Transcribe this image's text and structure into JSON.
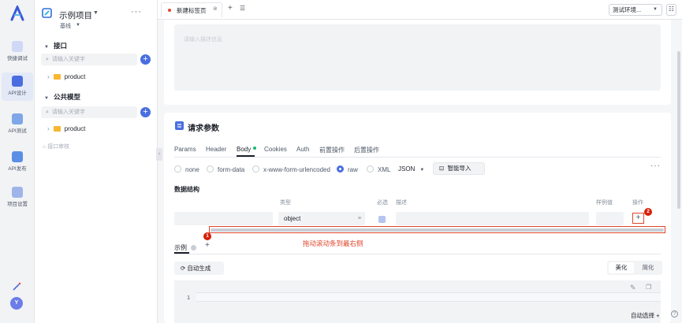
{
  "rail": {
    "items": [
      {
        "label": "快捷调试",
        "icon": "quick-debug-icon"
      },
      {
        "label": "API设计",
        "icon": "api-design-icon"
      },
      {
        "label": "API测试",
        "icon": "api-test-icon"
      },
      {
        "label": "API发布",
        "icon": "api-publish-icon"
      },
      {
        "label": "项目设置",
        "icon": "project-settings-icon"
      }
    ],
    "avatar": "Y"
  },
  "sidebar": {
    "project_name": "示例项目",
    "branch": "基线",
    "more": "···",
    "api_section": {
      "title": "接口",
      "search_placeholder": "请输入关键字",
      "folder": "product"
    },
    "model_section": {
      "title": "公共模型",
      "search_placeholder": "请输入关键字",
      "folder": "product"
    },
    "review": "接口审核"
  },
  "tabbar": {
    "tab_label": "新建标签页",
    "environment": "测试环境..."
  },
  "main": {
    "desc_placeholder": "请输入描述信息",
    "request_params_title": "请求参数",
    "subtabs": [
      "Params",
      "Header",
      "Body",
      "Cookies",
      "Auth",
      "前置操作",
      "后置操作"
    ],
    "body_types": [
      "none",
      "form-data",
      "x-www-form-urlencoded",
      "raw",
      "XML"
    ],
    "selected_body_type": "raw",
    "json_label": "JSON",
    "smart_import": "智能导入",
    "data_structure_title": "数据结构",
    "columns": {
      "type": "类型",
      "required": "必选",
      "desc": "描述",
      "sample": "样例值",
      "action": "操作"
    },
    "row": {
      "type_value": "object",
      "action_symbol": "+"
    },
    "badge1": "1",
    "badge2": "2",
    "note": "拖动滚动条到最右侧",
    "example_tab": "示例",
    "auto_generate": "自动生成",
    "beautify": "美化",
    "simplify": "简化",
    "line_number": "1"
  },
  "bottom": {
    "auto_select": "自动选择 +"
  },
  "colors": {
    "accent": "#4a6ee0",
    "annotation": "#e0452b",
    "success": "#19b86f"
  }
}
